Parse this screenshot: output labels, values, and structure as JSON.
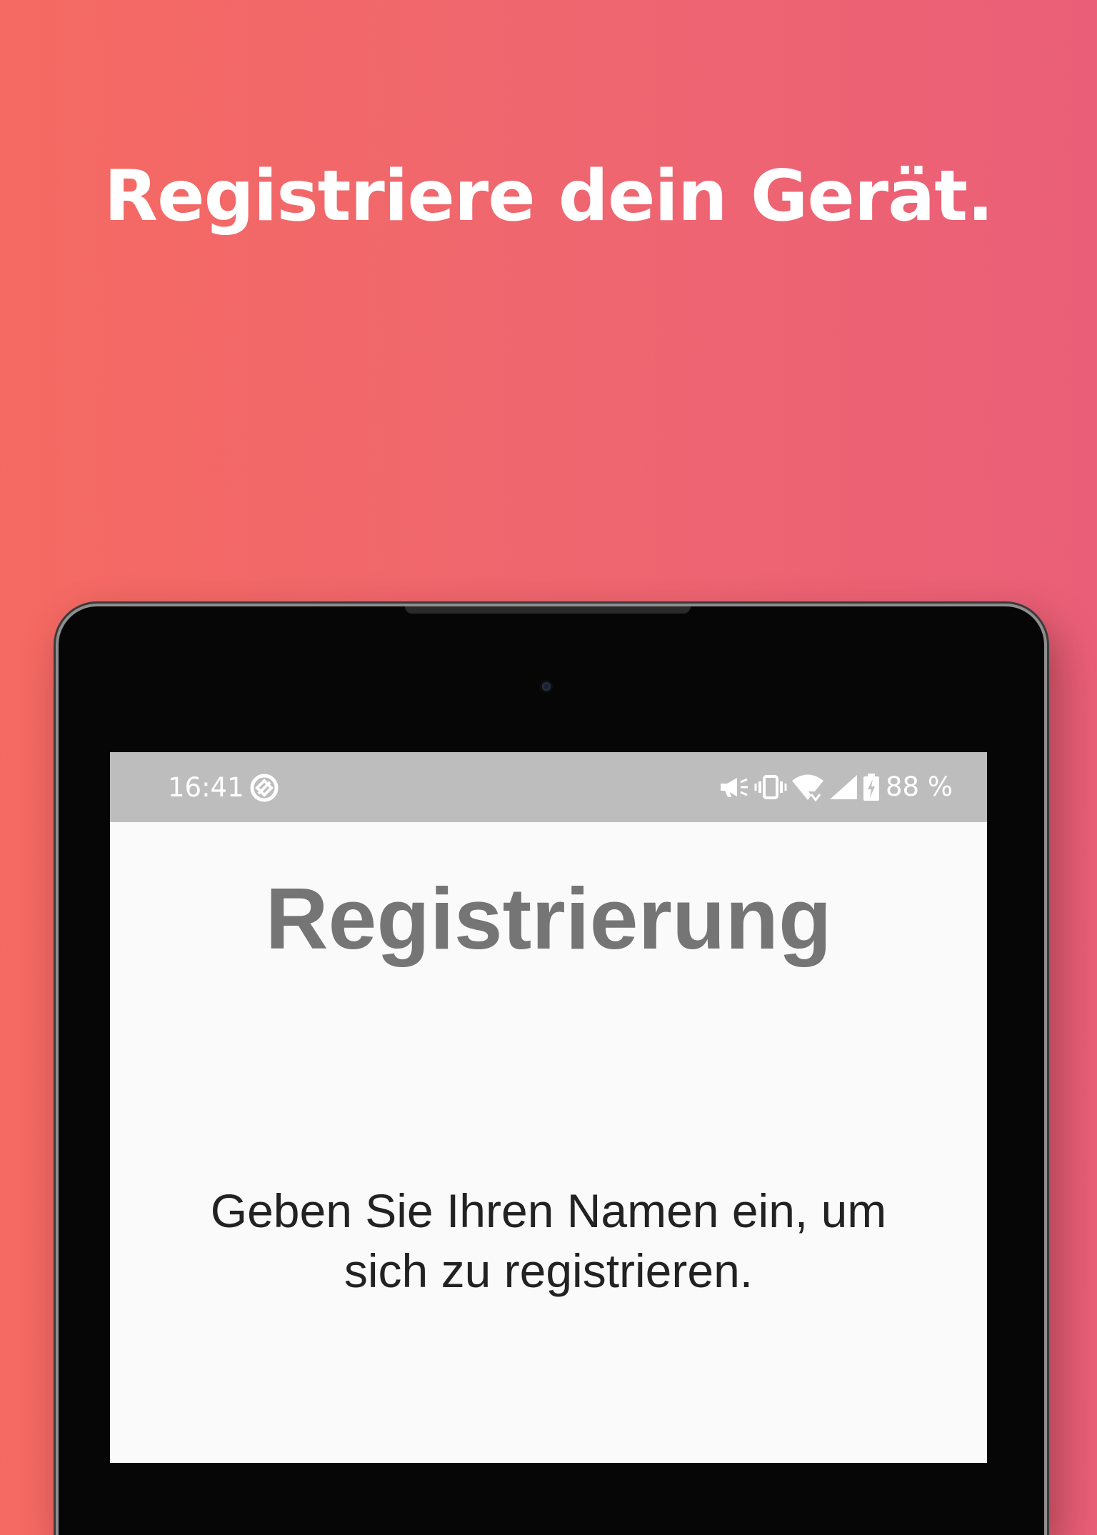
{
  "headline": "Registriere dein Gerät.",
  "status_bar": {
    "time": "16:41",
    "battery": "88 %",
    "icons": [
      "data-saver-icon",
      "megaphone-icon",
      "vibrate-icon",
      "wifi-icon",
      "cellular-signal-icon",
      "battery-charging-icon"
    ]
  },
  "screen": {
    "title": "Registrierung",
    "instructions": "Geben Sie Ihren Namen ein, um sich zu registrieren."
  },
  "colors": {
    "background_left": "#f56a62",
    "background_right": "#ea5f77",
    "status_bar": "#bdbdbd",
    "screen": "#fafafa",
    "title_text": "#757575",
    "body_text": "#222222"
  }
}
